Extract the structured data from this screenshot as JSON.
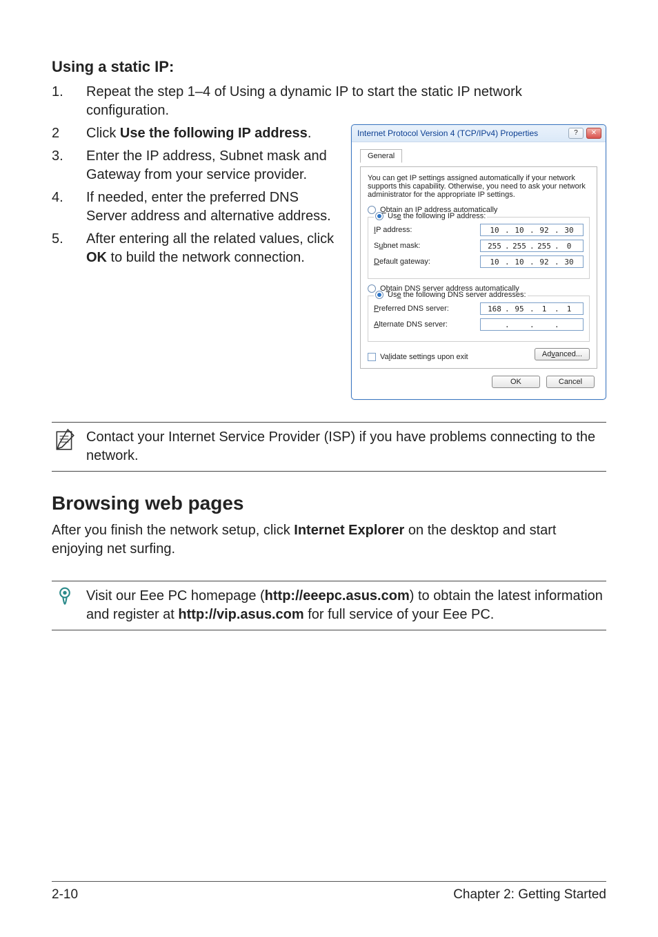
{
  "section1": {
    "heading": "Using a static IP:",
    "step1_num": "1.",
    "step1": "Repeat the step 1–4 of Using a dynamic IP to start the static IP network configuration.",
    "step2_num": "2",
    "step2_pre": "Click ",
    "step2_bold": "Use the following IP address",
    "step2_post": ".",
    "step3_num": "3.",
    "step3": "Enter the IP address, Subnet mask and Gateway from your service provider.",
    "step4_num": "4.",
    "step4": "If needed, enter the preferred DNS Server address and alternative address.",
    "step5_num": "5.",
    "step5_pre": "After entering all the related values, click ",
    "step5_bold": "OK",
    "step5_post": " to build the network connection."
  },
  "dialog": {
    "title": "Internet Protocol Version 4 (TCP/IPv4) Properties",
    "help_btn": "?",
    "close_btn": "✕",
    "tab": "General",
    "desc": "You can get IP settings assigned automatically if your network supports this capability. Otherwise, you need to ask your network administrator for the appropriate IP settings.",
    "r_auto_ip_u": "O",
    "r_auto_ip": "btain an IP address automatically",
    "r_use_ip_pre": "Us",
    "r_use_ip_u": "e",
    "r_use_ip_post": " the following IP address:",
    "lbl_ip_u": "I",
    "lbl_ip": "P address:",
    "lbl_sub_u": "u",
    "lbl_sub_pre": "S",
    "lbl_sub_post": "bnet mask:",
    "lbl_gw_u": "D",
    "lbl_gw": "efault gateway:",
    "r_auto_dns_pre": "O",
    "r_auto_dns_u": "b",
    "r_auto_dns_post": "tain DNS server address automatically",
    "r_use_dns_pre": "Us",
    "r_use_dns_u": "e",
    "r_use_dns_post": " the following DNS server addresses:",
    "lbl_pdns_u": "P",
    "lbl_pdns": "referred DNS server:",
    "lbl_adns_u": "A",
    "lbl_adns": "lternate DNS server:",
    "chk_validate_pre": "Va",
    "chk_validate_u": "l",
    "chk_validate_post": "idate settings upon exit",
    "btn_adv_pre": "Ad",
    "btn_adv_u": "v",
    "btn_adv_post": "anced...",
    "btn_ok": "OK",
    "btn_cancel": "Cancel",
    "ip": {
      "a": "10",
      "b": "10",
      "c": "92",
      "d": "30"
    },
    "mask": {
      "a": "255",
      "b": "255",
      "c": "255",
      "d": "0"
    },
    "gw": {
      "a": "10",
      "b": "10",
      "c": "92",
      "d": "30"
    },
    "pdns": {
      "a": "168",
      "b": "95",
      "c": "1",
      "d": "1"
    },
    "adns": {
      "a": "",
      "b": "",
      "c": "",
      "d": ""
    },
    "dot": "."
  },
  "note1": "Contact your Internet Service Provider (ISP) if you have problems connecting to the network.",
  "section2": {
    "heading": "Browsing web pages",
    "para_pre": "After you finish the network setup, click ",
    "para_bold": "Internet Explorer",
    "para_post": " on the desktop and start enjoying net surfing."
  },
  "note2": {
    "t1": "Visit our Eee PC homepage (",
    "b1": "http://eeepc.asus.com",
    "t2": ") to obtain the latest information and register at ",
    "b2": "http://vip.asus.com",
    "t3": " for full service of your Eee PC."
  },
  "footer": {
    "left": "2-10",
    "right": "Chapter 2: Getting Started"
  }
}
